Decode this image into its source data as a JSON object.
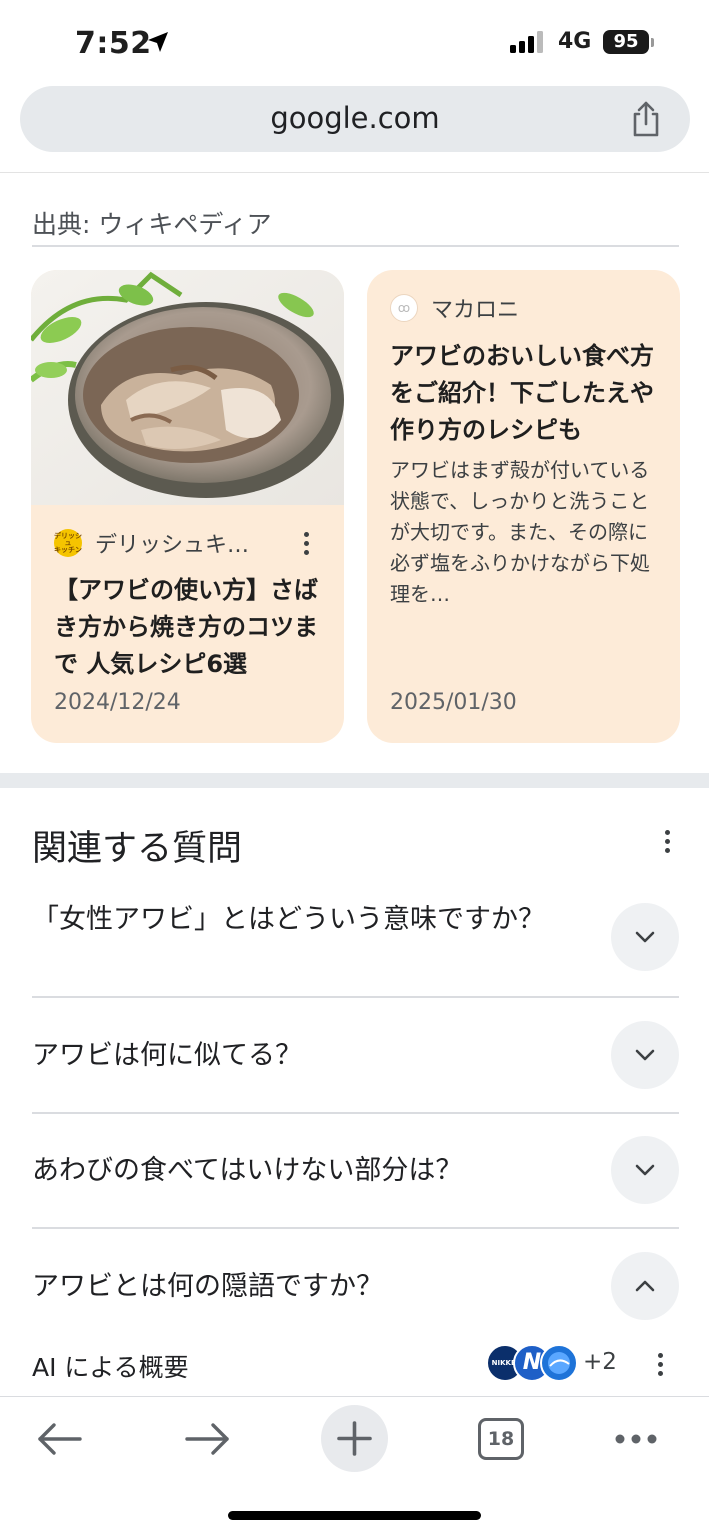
{
  "status_bar": {
    "time": "7:52",
    "network": "4G",
    "battery": "95"
  },
  "browser": {
    "url": "google.com"
  },
  "source_line": "出典: ウィキペディア",
  "cards": [
    {
      "site": "デリッシュキ…",
      "site_logo_text": "デリッシュ キッチン",
      "title": "【アワビの使い方】さばき方から焼き方のコツまで 人気レシピ6選",
      "date": "2024/12/24"
    },
    {
      "site": "マカロニ",
      "title": "アワビのおいしい食べ方をご紹介！下ごしたえや作り方のレシピも",
      "snippet": "アワビはまず殻が付いている状態で、しっかりと洗うことが大切です。また、その際に必ず塩をふりかけながら下処理を…",
      "date": "2025/01/30"
    }
  ],
  "related": {
    "title": "関連する質問",
    "questions": [
      {
        "text": "「女性アワビ」とはどういう意味ですか？",
        "expanded": false
      },
      {
        "text": "アワビは何に似てる？",
        "expanded": false
      },
      {
        "text": "あわびの食べてはいけない部分は？",
        "expanded": false
      },
      {
        "text": "アワビとは何の隠語ですか？",
        "expanded": true
      }
    ]
  },
  "ai_overview": {
    "label": "AI による概要",
    "source_avatars": [
      "NIKKEI",
      "N",
      ""
    ],
    "more_count": "+2"
  },
  "toolbar": {
    "tab_count": "18"
  }
}
